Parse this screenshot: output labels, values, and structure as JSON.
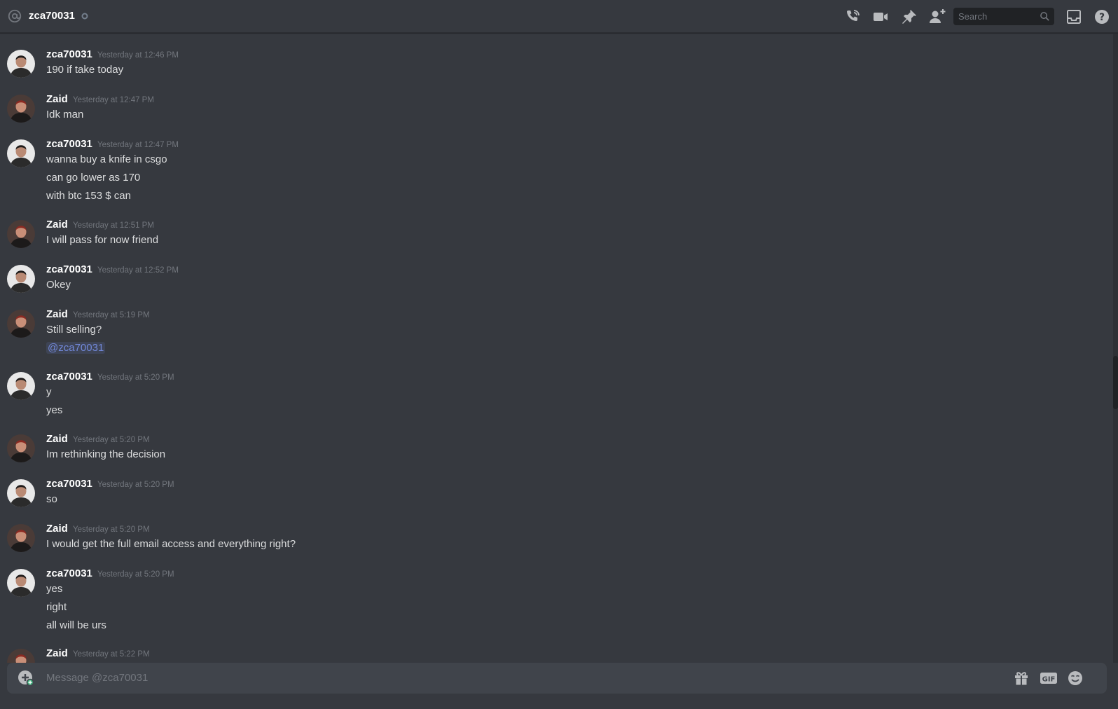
{
  "header": {
    "title": "zca70031",
    "search_placeholder": "Search",
    "icons": [
      "at-icon",
      "status-offline-icon",
      "voice-call-icon",
      "video-call-icon",
      "pin-icon",
      "add-friend-icon",
      "search-icon",
      "inbox-icon",
      "help-icon"
    ]
  },
  "messages": [
    {
      "author": "zca70031",
      "time": "Yesterday at 12:46 PM",
      "lines": [
        "190 if take today"
      ]
    },
    {
      "author": "Zaid",
      "time": "Yesterday at 12:47 PM",
      "lines": [
        "Idk man"
      ]
    },
    {
      "author": "zca70031",
      "time": "Yesterday at 12:47 PM",
      "lines": [
        "wanna buy a knife in csgo",
        "can go lower as 170",
        "with btc 153 $ can"
      ]
    },
    {
      "author": "Zaid",
      "time": "Yesterday at 12:51 PM",
      "lines": [
        "I will pass for now friend"
      ]
    },
    {
      "author": "zca70031",
      "time": "Yesterday at 12:52 PM",
      "lines": [
        "Okey"
      ]
    },
    {
      "author": "Zaid",
      "time": "Yesterday at 5:19 PM",
      "lines": [
        "Still selling?"
      ],
      "mention": "@zca70031"
    },
    {
      "author": "zca70031",
      "time": "Yesterday at 5:20 PM",
      "lines": [
        "y",
        "yes"
      ]
    },
    {
      "author": "Zaid",
      "time": "Yesterday at 5:20 PM",
      "lines": [
        "Im rethinking the decision"
      ]
    },
    {
      "author": "zca70031",
      "time": "Yesterday at 5:20 PM",
      "lines": [
        "so"
      ]
    },
    {
      "author": "Zaid",
      "time": "Yesterday at 5:20 PM",
      "lines": [
        "I would get the full email access and everything right?"
      ]
    },
    {
      "author": "zca70031",
      "time": "Yesterday at 5:20 PM",
      "lines": [
        "yes",
        "right",
        "all will be urs"
      ]
    },
    {
      "author": "Zaid",
      "time": "Yesterday at 5:22 PM",
      "lines": []
    }
  ],
  "composer": {
    "placeholder": "Message @zca70031",
    "gif_label": "GIF",
    "icons": [
      "upload-icon",
      "gift-icon",
      "gif-icon",
      "emoji-icon"
    ]
  },
  "colors": {
    "background": "#36393f",
    "composer": "#40444b",
    "username": "#ffffff",
    "timestamp": "#72767d",
    "message_text": "#dcddde",
    "mention": "#7289da"
  }
}
